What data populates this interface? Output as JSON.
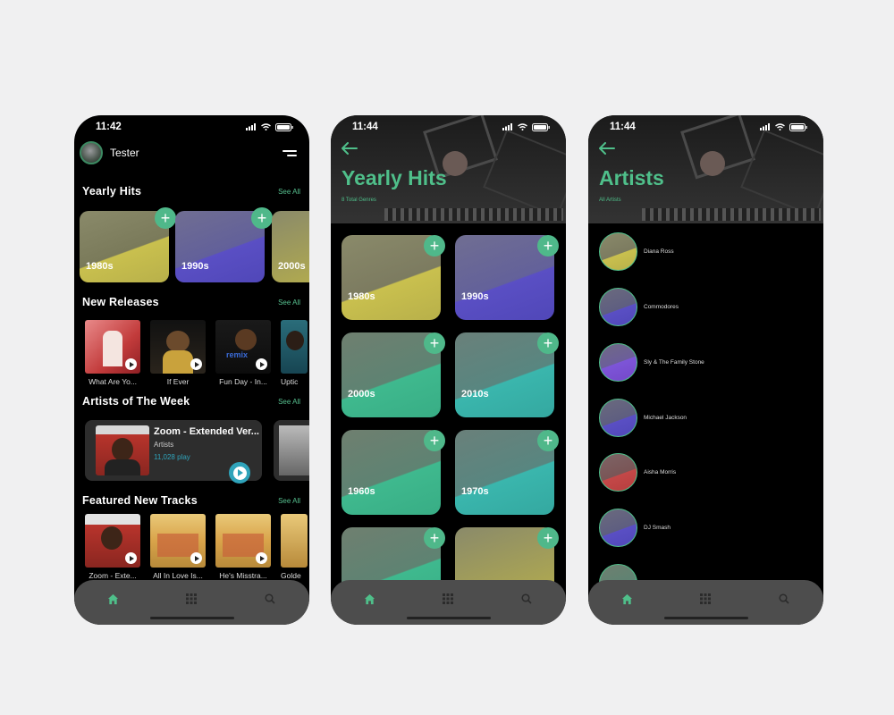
{
  "colors": {
    "accent": "#4fbf8a",
    "play_blue": "#2fa3ba",
    "tabbar": "#4d4d4d",
    "background": "#f0f0f1"
  },
  "screen1": {
    "time": "11:42",
    "user": {
      "name": "Tester"
    },
    "sections": {
      "yearly_hits": {
        "title": "Yearly Hits",
        "see_all": "See All"
      },
      "new_releases": {
        "title": "New Releases",
        "see_all": "See All"
      },
      "artists_week": {
        "title": "Artists of The Week",
        "see_all": "See All"
      },
      "featured": {
        "title": "Featured New Tracks",
        "see_all": "See All"
      }
    },
    "genres": [
      "1980s",
      "1990s",
      "2000s"
    ],
    "new_releases": [
      "What Are Yo...",
      "If Ever",
      "Fun Day - In...",
      "Uptic"
    ],
    "artist_card": {
      "title": "Zoom - Extended Ver...",
      "type": "Artists",
      "plays": "11,028 play"
    },
    "featured_tracks": [
      "Zoom - Exte...",
      "All In Love Is...",
      "He's Misstra...",
      "Golde"
    ]
  },
  "screen2": {
    "time": "11:44",
    "title": "Yearly Hits",
    "subtitle": "8 Total Genres",
    "genres": [
      "1980s",
      "1990s",
      "2000s",
      "2010s",
      "1960s",
      "1970s",
      "",
      ""
    ]
  },
  "screen3": {
    "time": "11:44",
    "title": "Artists",
    "subtitle": "All Artists",
    "artists": [
      "Diana Ross",
      "Commodores",
      "Sly & The Family Stone",
      "Michael Jackson",
      "Aisha Morris",
      "DJ Smash",
      ""
    ]
  },
  "tabbar": {
    "icons": [
      "home-icon",
      "grid-icon",
      "search-icon"
    ]
  }
}
